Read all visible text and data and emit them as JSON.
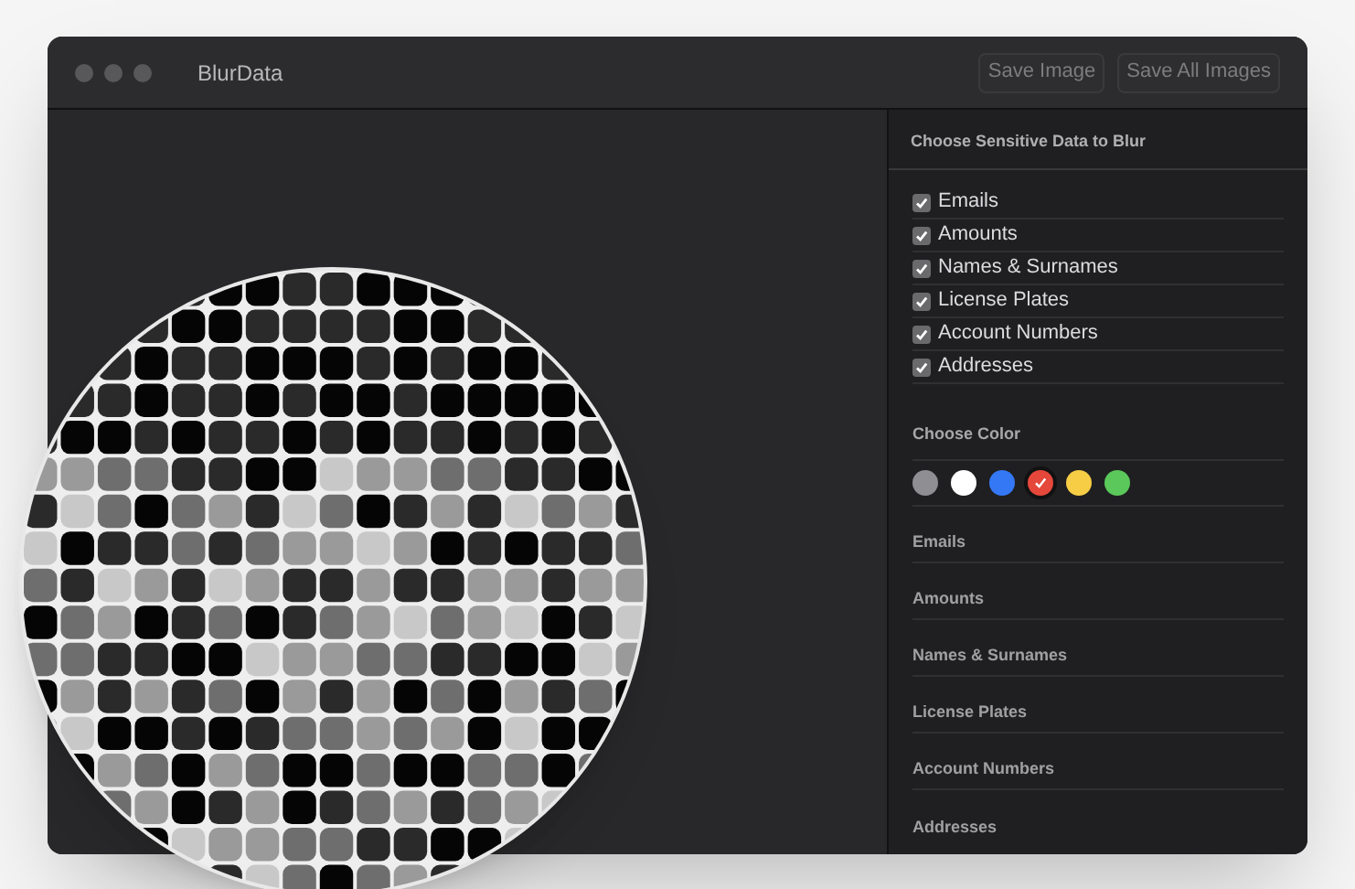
{
  "window": {
    "title": "BlurData"
  },
  "toolbar": {
    "buttons": [
      "Save Image",
      "Save All Images"
    ]
  },
  "sidebar": {
    "data_section": {
      "title": "Choose Sensitive Data to Blur",
      "items": [
        {
          "label": "Emails",
          "checked": true
        },
        {
          "label": "Amounts",
          "checked": true
        },
        {
          "label": "Names & Surnames",
          "checked": true
        },
        {
          "label": "License Plates",
          "checked": true
        },
        {
          "label": "Account Numbers",
          "checked": true
        },
        {
          "label": "Addresses",
          "checked": true
        }
      ]
    },
    "color_section": {
      "title": "Choose Color",
      "colors": [
        {
          "color": "#8e8e93",
          "selected": false
        },
        {
          "color": "#ffffff",
          "selected": false
        },
        {
          "color": "#3478f6",
          "selected": false
        },
        {
          "color": "#e5483b",
          "selected": true
        },
        {
          "color": "#f7cd46",
          "selected": false
        },
        {
          "color": "#5ac85a",
          "selected": false
        }
      ]
    },
    "fields": [
      "Emails",
      "Amounts",
      "Names & Surnames",
      "License Plates",
      "Account Numbers",
      "Addresses"
    ]
  }
}
